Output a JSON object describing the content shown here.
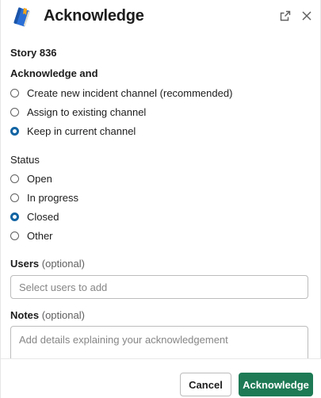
{
  "header": {
    "title": "Acknowledge",
    "app_icon": "notebook-icon",
    "popout_icon": "popout-icon",
    "close_icon": "close-icon"
  },
  "story": "Story 836",
  "acknowledge": {
    "label": "Acknowledge and",
    "options": [
      {
        "label": "Create new incident channel (recommended)",
        "checked": false
      },
      {
        "label": "Assign to existing channel",
        "checked": false
      },
      {
        "label": "Keep in current channel",
        "checked": true
      }
    ]
  },
  "status": {
    "label": "Status",
    "options": [
      {
        "label": "Open",
        "checked": false
      },
      {
        "label": "In progress",
        "checked": false
      },
      {
        "label": "Closed",
        "checked": true
      },
      {
        "label": "Other",
        "checked": false
      }
    ]
  },
  "users": {
    "label": "Users",
    "optional": "(optional)",
    "placeholder": "Select users to add"
  },
  "notes": {
    "label": "Notes",
    "optional": "(optional)",
    "placeholder": "Add details explaining your acknowledgement"
  },
  "footer": {
    "cancel_label": "Cancel",
    "submit_label": "Acknowledge"
  },
  "colors": {
    "accent": "#1264a3",
    "primary_button": "#1d7a55"
  }
}
